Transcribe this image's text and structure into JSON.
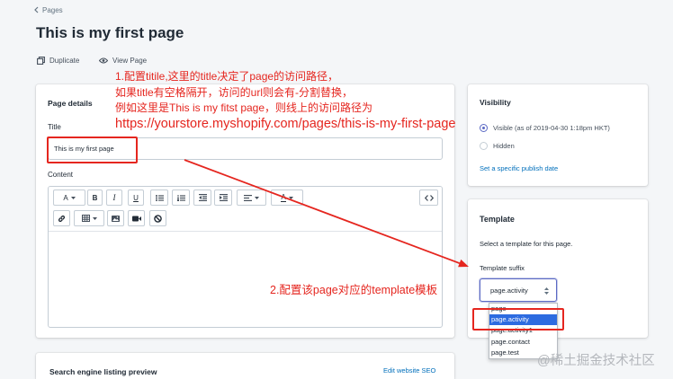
{
  "breadcrumb": {
    "label": "Pages",
    "icon": "chevron-left-icon"
  },
  "page": {
    "title": "This is my first page"
  },
  "actions": {
    "duplicate": {
      "label": "Duplicate",
      "icon": "duplicate-icon"
    },
    "view_page": {
      "label": "View Page",
      "icon": "eye-icon"
    }
  },
  "page_details": {
    "heading": "Page details",
    "title_label": "Title",
    "title_value": "This is my first page",
    "content_label": "Content"
  },
  "editor": {
    "font_size": {
      "label": "A",
      "icon": "chevron-down-icon"
    },
    "bold": {
      "label": "B"
    },
    "italic": {
      "label": "I"
    },
    "underline": {
      "label": "U"
    },
    "text_color": {
      "label": "A",
      "icon": "chevron-down-icon"
    },
    "icons": {
      "bulleted_list": "bulleted-list-icon",
      "numbered_list": "numbered-list-icon",
      "outdent": "outdent-icon",
      "indent": "indent-icon",
      "align": "align-left-icon",
      "html": "code-icon",
      "link": "link-icon",
      "table": "table-icon",
      "image": "image-icon",
      "video": "video-icon",
      "clear_formatting": "clear-formatting-icon"
    }
  },
  "visibility": {
    "heading": "Visibility",
    "options": [
      {
        "label": "Visible (as of 2019-04-30 1:18pm HKT)",
        "checked": true
      },
      {
        "label": "Hidden",
        "checked": false
      }
    ],
    "publish_date_link": "Set a specific publish date"
  },
  "template": {
    "heading": "Template",
    "description": "Select a template for this page.",
    "suffix_label": "Template suffix",
    "selected": "page.activity",
    "select_icon": "select-arrows-icon",
    "options": [
      "page",
      "page.activity",
      "page.activity1",
      "page.contact",
      "page.test"
    ],
    "highlighted_index": 1
  },
  "seo": {
    "heading": "Search engine listing preview",
    "edit_link": "Edit website SEO"
  },
  "annotations": {
    "note1_lines": [
      "1.配置titile,这里的title决定了page的访问路径，",
      "如果title有空格隔开，访问的url则会有-分割替换，",
      "例如这里是This is my fitst page，则线上的访问路径为",
      "https://yourstore.myshopify.com/pages/this-is-my-first-page"
    ],
    "note2": "2.配置该page对应的template模板"
  },
  "watermark": "@稀土掘金技术社区",
  "colors": {
    "background": "#f4f6f8",
    "annotation_red": "#e5261f",
    "link": "#006fbb",
    "radio_accent": "#5c6ac4",
    "dropdown_highlight": "#2d6be0"
  }
}
